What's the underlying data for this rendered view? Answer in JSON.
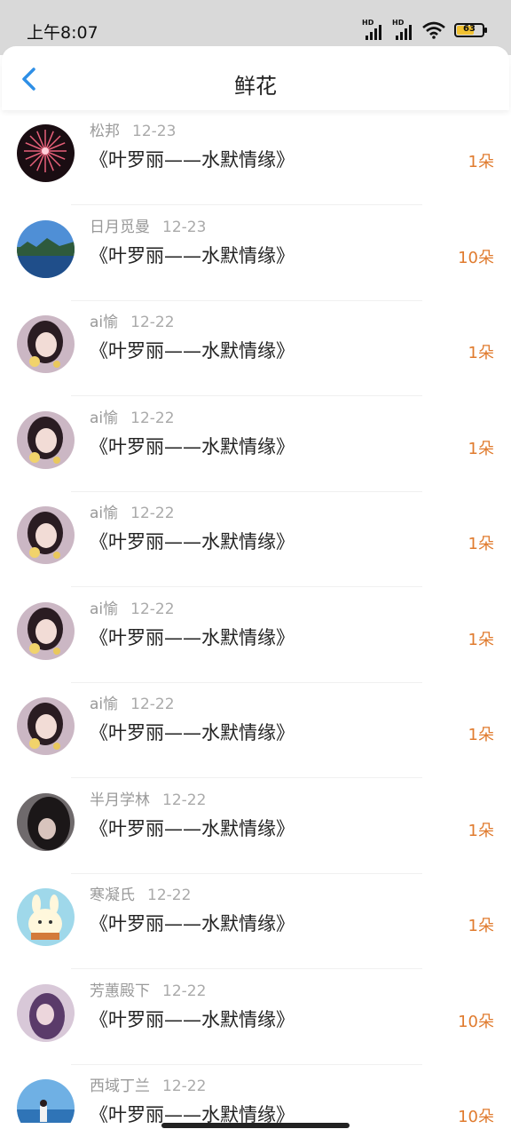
{
  "status_bar": {
    "time": "上午8:07",
    "signal_label": "HD",
    "battery": "63"
  },
  "header": {
    "title": "鲜花",
    "back_icon": "chevron-left-icon"
  },
  "colors": {
    "accent_blue": "#2e8fe6",
    "count_orange": "#e07b2e",
    "status_bg": "#d9d9d9"
  },
  "items": [
    {
      "name": "松邦",
      "date": "12-23",
      "book": "《叶罗丽——水默情缘》",
      "count": "1朵",
      "avatar": "fireworks"
    },
    {
      "name": "日月觅曼",
      "date": "12-23",
      "book": "《叶罗丽——水默情缘》",
      "count": "10朵",
      "avatar": "landscape"
    },
    {
      "name": "ai愉",
      "date": "12-22",
      "book": "《叶罗丽——水默情缘》",
      "count": "1朵",
      "avatar": "girl"
    },
    {
      "name": "ai愉",
      "date": "12-22",
      "book": "《叶罗丽——水默情缘》",
      "count": "1朵",
      "avatar": "girl"
    },
    {
      "name": "ai愉",
      "date": "12-22",
      "book": "《叶罗丽——水默情缘》",
      "count": "1朵",
      "avatar": "girl"
    },
    {
      "name": "ai愉",
      "date": "12-22",
      "book": "《叶罗丽——水默情缘》",
      "count": "1朵",
      "avatar": "girl"
    },
    {
      "name": "ai愉",
      "date": "12-22",
      "book": "《叶罗丽——水默情缘》",
      "count": "1朵",
      "avatar": "girl"
    },
    {
      "name": "半月学林",
      "date": "12-22",
      "book": "《叶罗丽——水默情缘》",
      "count": "1朵",
      "avatar": "dark-hair"
    },
    {
      "name": "寒凝氏",
      "date": "12-22",
      "book": "《叶罗丽——水默情缘》",
      "count": "1朵",
      "avatar": "cartoon"
    },
    {
      "name": "芳蕙殿下",
      "date": "12-22",
      "book": "《叶罗丽——水默情缘》",
      "count": "10朵",
      "avatar": "purple-girl"
    },
    {
      "name": "西域丁兰",
      "date": "12-22",
      "book": "《叶罗丽——水默情缘》",
      "count": "10朵",
      "avatar": "sea"
    }
  ]
}
